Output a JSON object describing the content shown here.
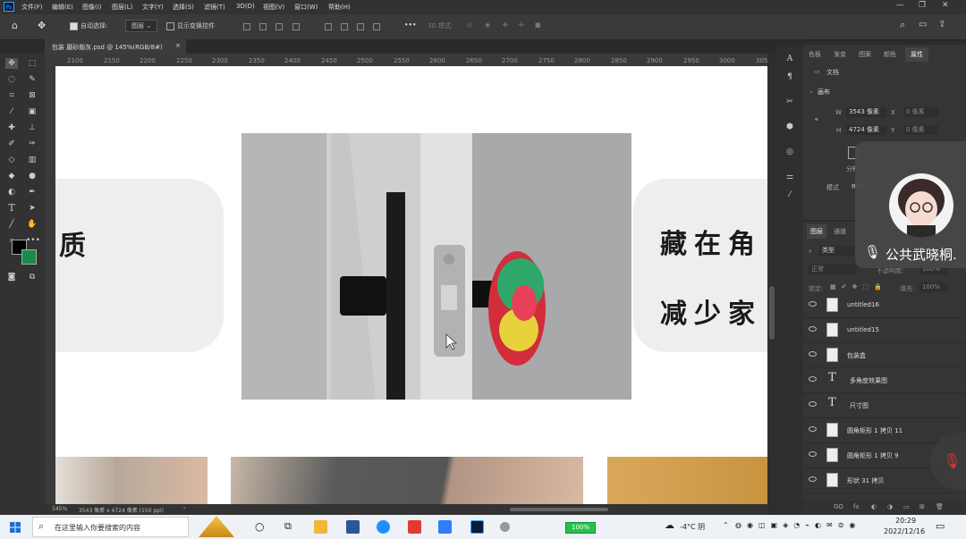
{
  "app": {
    "logo": "Ps"
  },
  "menu": [
    "文件(F)",
    "编辑(E)",
    "图像(I)",
    "图层(L)",
    "文字(Y)",
    "选择(S)",
    "滤镜(T)",
    "3D(D)",
    "视图(V)",
    "窗口(W)",
    "帮助(H)"
  ],
  "window_controls": [
    "—",
    "❐",
    "✕"
  ],
  "options": {
    "auto_select_label": "自动选择:",
    "auto_select_value": "图层",
    "show_transform_label": "显示变换控件",
    "mode_3d": "3D 模式:",
    "more": "•••"
  },
  "document_tab": {
    "title": "包装 磨砂版灰.psd @ 145%(RGB/8#)",
    "close": "×"
  },
  "ruler": {
    "labels": [
      "2100",
      "2150",
      "2200",
      "2250",
      "2300",
      "2350",
      "2400",
      "2450",
      "2500",
      "2550",
      "2600",
      "2650",
      "2700",
      "2750",
      "2800",
      "2850",
      "2900",
      "2950",
      "3000",
      "305"
    ]
  },
  "canvas": {
    "left_text": "质",
    "right_line1": "藏在角",
    "right_line2": "减少家"
  },
  "status": {
    "zoom": "145%",
    "info": "3543 像素 x 4724 像素 (150 ppi)",
    "arrow": "›"
  },
  "properties_panel": {
    "tabs": [
      "色板",
      "渐变",
      "图案",
      "颜色",
      "属性"
    ],
    "doc_label": "文档",
    "section": "画布",
    "w_label": "W",
    "w_value": "3543 像素",
    "h_label": "H",
    "h_value": "4724 像素",
    "x_label": "X",
    "y_label": "Y",
    "x_value": "0 像素",
    "y_value": "0 像素",
    "res_label": "分辨",
    "mode_label": "模式",
    "mode_value": "RGB"
  },
  "layers_panel": {
    "tabs": [
      "图层",
      "通道"
    ],
    "filter_kind": "类型",
    "blend_mode": "正常",
    "opacity_label": "不透明度:",
    "opacity_value": "100%",
    "lock_label": "锁定:",
    "fill_label": "填充:",
    "fill_value": "100%",
    "layers": [
      {
        "name": "untitled16",
        "kind": "smart"
      },
      {
        "name": "untitled15",
        "kind": "smart"
      },
      {
        "name": "包装盒",
        "kind": "smart"
      },
      {
        "name": "多角度效果图",
        "kind": "text"
      },
      {
        "name": "尺寸图",
        "kind": "text"
      },
      {
        "name": "圆角矩形 1 拷贝 11",
        "kind": "shape"
      },
      {
        "name": "圆角矩形 1 拷贝 9",
        "kind": "shape"
      },
      {
        "name": "形状 31 拷贝",
        "kind": "shape"
      }
    ],
    "bottom_icons": [
      "GO",
      "fx",
      "◐",
      "◑",
      "▭",
      "⊞",
      "🗑"
    ]
  },
  "meeting_overlay": {
    "name": "公共武晓桐."
  },
  "taskbar": {
    "search_placeholder": "在这里输入你要搜索的内容",
    "battery": "100%",
    "weather": "-4°C 阴",
    "time": "20:29",
    "date": "2022/12/16"
  },
  "colors": {
    "accent": "#31a8ff",
    "fg": "#000000",
    "bg": "#1a8a4a"
  }
}
